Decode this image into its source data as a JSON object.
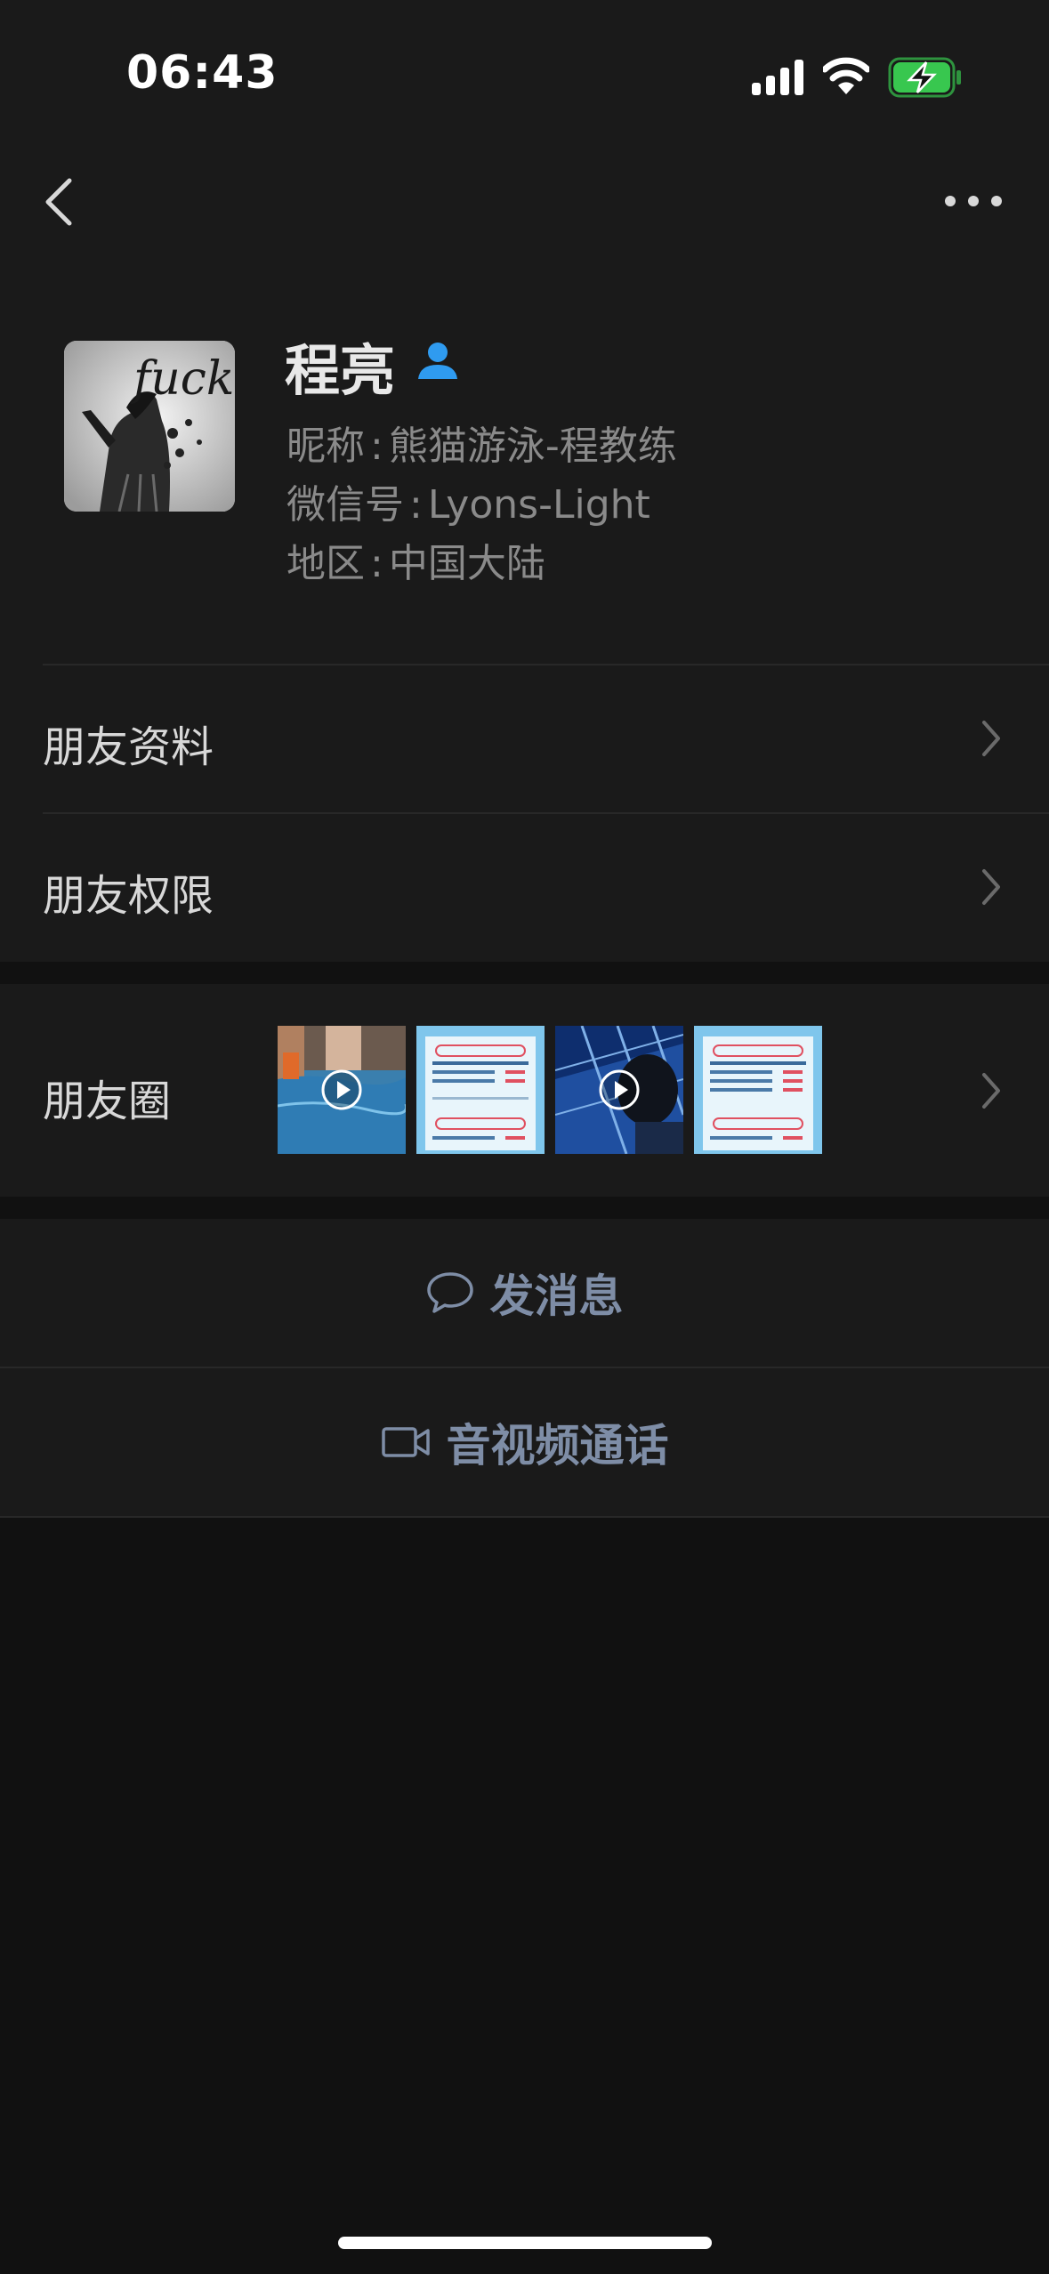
{
  "status_bar": {
    "time": "06:43"
  },
  "profile": {
    "name": "程亮",
    "avatar_text": "fuck",
    "nickname_label": "昵称",
    "nickname": "熊猫游泳-程教练",
    "wechat_id_label": "微信号",
    "wechat_id": "Lyons-Light",
    "region_label": "地区",
    "region": "中国大陆"
  },
  "menu": {
    "friend_info": "朋友资料",
    "friend_permissions": "朋友权限",
    "moments": "朋友圈"
  },
  "actions": {
    "send_message": "发消息",
    "video_call": "音视频通话"
  },
  "colors": {
    "background": "#111111",
    "panel": "#1a1a1a",
    "action_text": "#7e8da6",
    "badge_blue": "#2f9bf0",
    "battery_green": "#38c74f"
  }
}
